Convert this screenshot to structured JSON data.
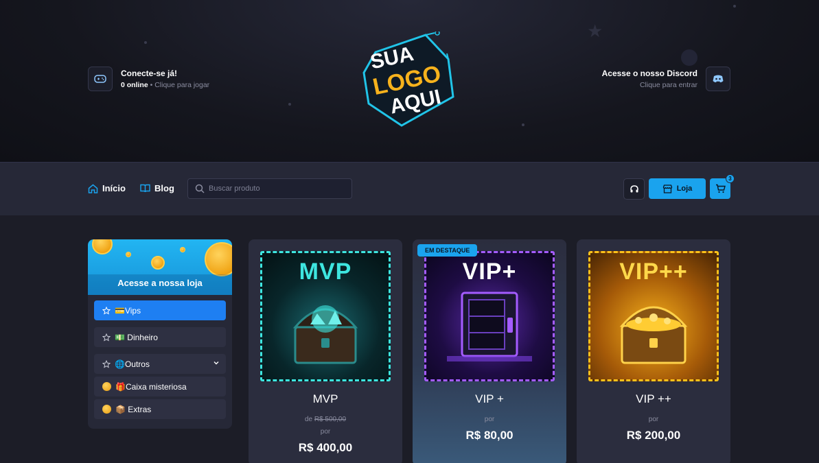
{
  "header": {
    "server": {
      "title": "Conecte-se já!",
      "online_count": "0 online",
      "separator": " • ",
      "cta": "Clique para jogar"
    },
    "logo": {
      "line1": "SUA",
      "line2": "LOGO",
      "line3": "AQUI"
    },
    "discord": {
      "title": "Acesse o nosso Discord",
      "cta": "Clique para entrar"
    }
  },
  "nav": {
    "links": [
      {
        "label": "Início",
        "icon": "home-icon"
      },
      {
        "label": "Blog",
        "icon": "book-icon"
      }
    ],
    "search": {
      "placeholder": "Buscar produto",
      "value": ""
    },
    "store_label": "Loja",
    "cart_count": "3"
  },
  "sidebar": {
    "banner_title": "Acesse a nossa loja",
    "items": [
      {
        "label": "💳Vips",
        "active": true
      },
      {
        "label": "💵 Dinheiro"
      },
      {
        "label": "🌐Outros",
        "expandable": true
      }
    ],
    "subitems": [
      {
        "label": "🎁Caixa misteriosa"
      },
      {
        "label": "📦 Extras"
      }
    ]
  },
  "products": [
    {
      "name": "MVP",
      "art_label": "MVP",
      "old_prefix": "de",
      "old_price": "R$ 500,00",
      "por": "por",
      "price": "R$ 400,00",
      "featured": false
    },
    {
      "name": "VIP +",
      "art_label": "VIP+",
      "badge": "EM DESTAQUE",
      "por": "por",
      "price": "R$ 80,00",
      "featured": true
    },
    {
      "name": "VIP ++",
      "art_label": "VIP++",
      "por": "por",
      "price": "R$ 200,00",
      "featured": false
    }
  ],
  "colors": {
    "accent": "#1aa3ee",
    "active": "#1e7ff2",
    "mvp": "#3ee6e0",
    "vip_plus": "#a45cff",
    "vip_plus_plus": "#ffc21a"
  }
}
